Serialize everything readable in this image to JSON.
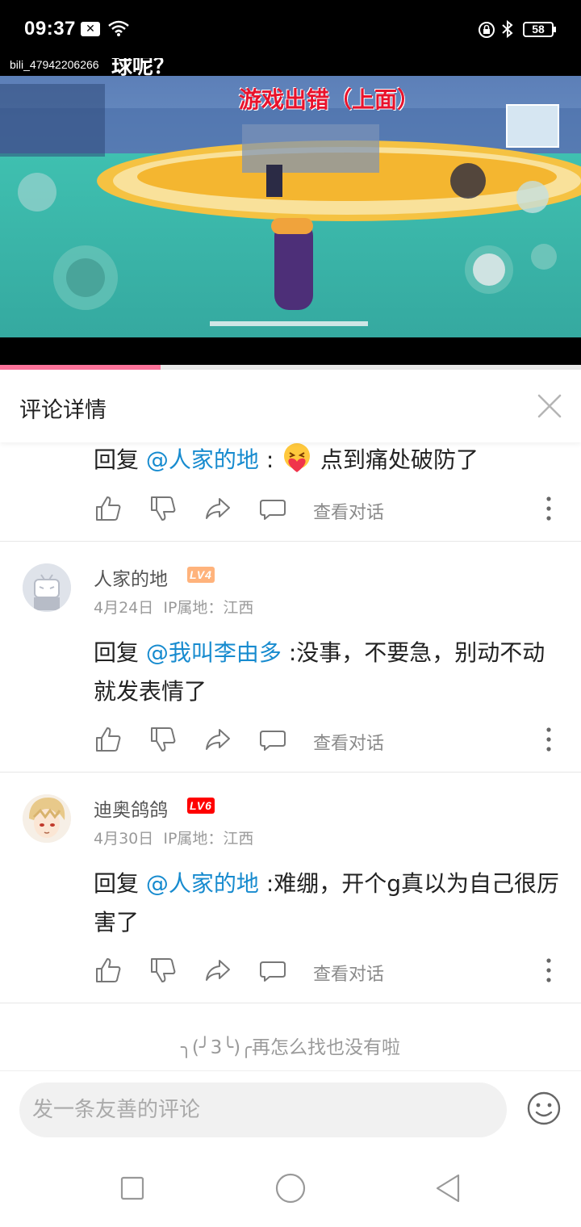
{
  "status_bar": {
    "time": "09:37",
    "x_badge": "✕",
    "battery": "58"
  },
  "video": {
    "uploader": "bili_47942206266",
    "title": "球呢？",
    "overlay_text": "游戏出错（上面）",
    "progress_fraction": 0.277,
    "accent_color": "#fb7299"
  },
  "header": {
    "title": "评论详情",
    "close_icon": "close-icon"
  },
  "comments": [
    {
      "reply_prefix": "回复 ",
      "mention": "@人家的地",
      "separator": " : ",
      "emoji": "love-hug-emoji",
      "text": " 点到痛处破防了",
      "view_conversation": "查看对话"
    },
    {
      "username": "人家的地",
      "level": "LV4",
      "level_color": "#ffb37c",
      "date": "4月24日",
      "ip": "IP属地：江西",
      "reply_prefix": "回复 ",
      "mention": "@我叫李由多",
      "text": " :没事，不要急，别动不动就发表情了",
      "view_conversation": "查看对话"
    },
    {
      "username": "迪奥鸽鸽",
      "level": "LV6",
      "level_color": "#ff0000",
      "date": "4月30日",
      "ip": "IP属地：江西",
      "reply_prefix": "回复 ",
      "mention": "@人家的地",
      "text": " :难绷，开个g真以为自己很厉害了",
      "view_conversation": "查看对话"
    }
  ],
  "end_text": "╮(╯3╰)╭再怎么找也没有啦",
  "input": {
    "placeholder": "发一条友善的评论"
  },
  "navbar": {
    "icons": [
      "square-recents-icon",
      "circle-home-icon",
      "triangle-back-icon"
    ]
  }
}
